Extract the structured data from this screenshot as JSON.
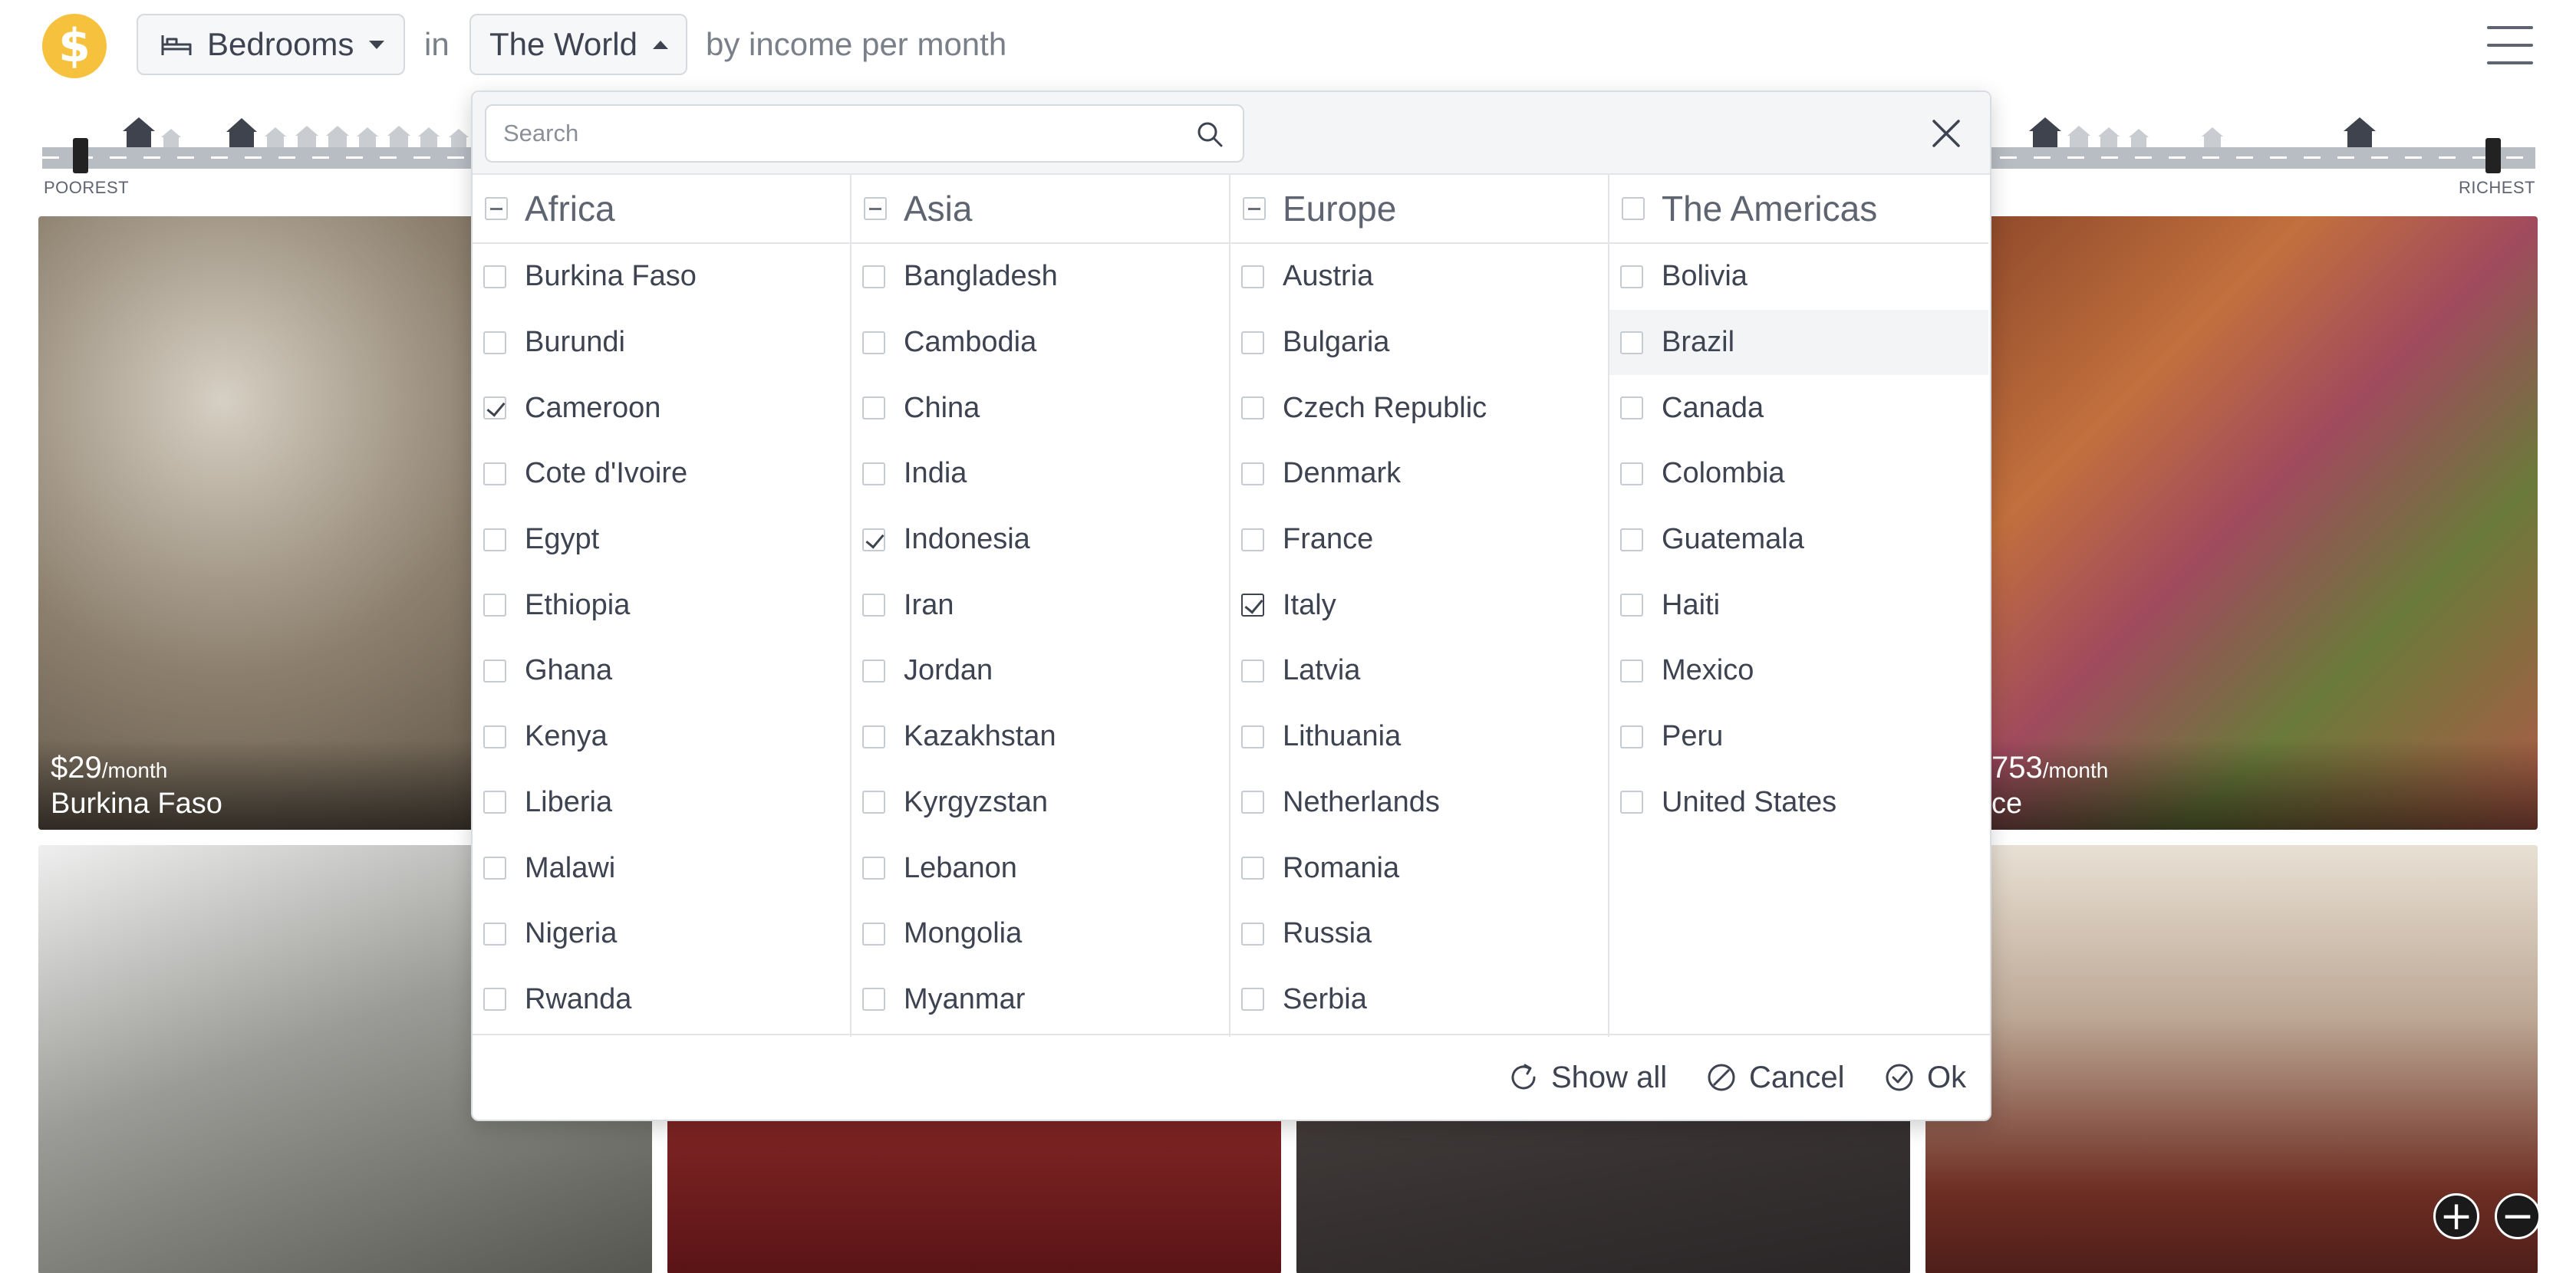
{
  "header": {
    "logo_symbol": "$",
    "things_label": "Bedrooms",
    "in_label": "in",
    "place_label": "The World",
    "by_label": "by income per month"
  },
  "street": {
    "poorest_label": "POOREST",
    "richest_label": "RICHEST"
  },
  "photos": [
    {
      "income": "$29",
      "unit": "/month",
      "country": "Burkina Faso"
    },
    {
      "income": "753",
      "unit": "/month",
      "country": "ce"
    }
  ],
  "filter": {
    "search_placeholder": "Search",
    "columns": [
      {
        "region": "Africa",
        "state": "partial",
        "countries": [
          {
            "name": "Burkina Faso",
            "checked": false
          },
          {
            "name": "Burundi",
            "checked": false
          },
          {
            "name": "Cameroon",
            "checked": true
          },
          {
            "name": "Cote d'Ivoire",
            "checked": false
          },
          {
            "name": "Egypt",
            "checked": false
          },
          {
            "name": "Ethiopia",
            "checked": false
          },
          {
            "name": "Ghana",
            "checked": false
          },
          {
            "name": "Kenya",
            "checked": false
          },
          {
            "name": "Liberia",
            "checked": false
          },
          {
            "name": "Malawi",
            "checked": false
          },
          {
            "name": "Nigeria",
            "checked": false
          },
          {
            "name": "Rwanda",
            "checked": false
          }
        ]
      },
      {
        "region": "Asia",
        "state": "partial",
        "countries": [
          {
            "name": "Bangladesh",
            "checked": false
          },
          {
            "name": "Cambodia",
            "checked": false
          },
          {
            "name": "China",
            "checked": false
          },
          {
            "name": "India",
            "checked": false
          },
          {
            "name": "Indonesia",
            "checked": true
          },
          {
            "name": "Iran",
            "checked": false
          },
          {
            "name": "Jordan",
            "checked": false
          },
          {
            "name": "Kazakhstan",
            "checked": false
          },
          {
            "name": "Kyrgyzstan",
            "checked": false
          },
          {
            "name": "Lebanon",
            "checked": false
          },
          {
            "name": "Mongolia",
            "checked": false
          },
          {
            "name": "Myanmar",
            "checked": false
          }
        ]
      },
      {
        "region": "Europe",
        "state": "partial",
        "countries": [
          {
            "name": "Austria",
            "checked": false
          },
          {
            "name": "Bulgaria",
            "checked": false
          },
          {
            "name": "Czech Republic",
            "checked": false
          },
          {
            "name": "Denmark",
            "checked": false
          },
          {
            "name": "France",
            "checked": false
          },
          {
            "name": "Italy",
            "checked": true,
            "focused": true
          },
          {
            "name": "Latvia",
            "checked": false
          },
          {
            "name": "Lithuania",
            "checked": false
          },
          {
            "name": "Netherlands",
            "checked": false
          },
          {
            "name": "Romania",
            "checked": false
          },
          {
            "name": "Russia",
            "checked": false
          },
          {
            "name": "Serbia",
            "checked": false
          }
        ]
      },
      {
        "region": "The Americas",
        "state": "none",
        "countries": [
          {
            "name": "Bolivia",
            "checked": false
          },
          {
            "name": "Brazil",
            "checked": false,
            "hover": true
          },
          {
            "name": "Canada",
            "checked": false
          },
          {
            "name": "Colombia",
            "checked": false
          },
          {
            "name": "Guatemala",
            "checked": false
          },
          {
            "name": "Haiti",
            "checked": false
          },
          {
            "name": "Mexico",
            "checked": false
          },
          {
            "name": "Peru",
            "checked": false
          },
          {
            "name": "United States",
            "checked": false
          }
        ]
      }
    ],
    "footer": {
      "show_all_label": "Show all",
      "cancel_label": "Cancel",
      "ok_label": "Ok"
    }
  },
  "zoom": {
    "in_symbol": "+",
    "out_symbol": "−"
  },
  "colors": {
    "accent": "#f6c23e",
    "text": "#3d4350",
    "border": "#d6d9de"
  },
  "icons": [
    "logo-dollar-icon",
    "bed-icon",
    "hamburger-menu-icon",
    "search-icon",
    "close-icon",
    "refresh-icon",
    "cancel-icon",
    "check-circle-icon",
    "zoom-in-icon",
    "zoom-out-icon"
  ]
}
